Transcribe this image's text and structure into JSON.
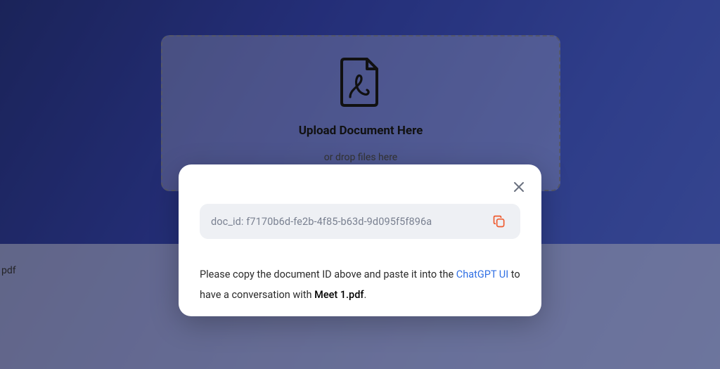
{
  "dropzone": {
    "title": "Upload Document Here",
    "subtitle": "or drop files here"
  },
  "strip": {
    "partial_filename": "pdf"
  },
  "modal": {
    "doc_id_label": "doc_id: f7170b6d-fe2b-4f85-b63d-9d095f5f896a",
    "instruction_pre": "Please copy the document ID above and paste it into the ",
    "chat_link_text": "ChatGPT UI",
    "instruction_mid": " to have a conversation with ",
    "filename": "Meet 1.pdf",
    "instruction_end": "."
  }
}
